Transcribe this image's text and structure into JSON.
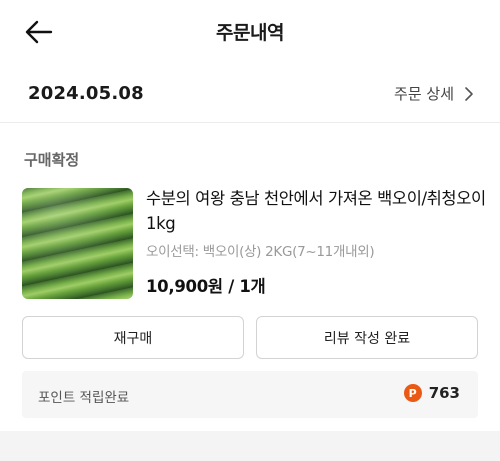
{
  "header": {
    "title": "주문내역",
    "back_icon": "arrow-left-icon"
  },
  "order": {
    "date": "2024.05.08",
    "detail_link_label": "주문 상세",
    "detail_icon": "chevron-right-icon",
    "status": "구매확정"
  },
  "product": {
    "name": "수분의 여왕 충남 천안에서 가져온 백오이/취청오이 1kg",
    "option": "오이선택: 백오이(상) 2KG(7~11개내외)",
    "price": "10,900원 / 1개",
    "thumbnail": "cucumber-photo"
  },
  "actions": {
    "rebuy_label": "재구매",
    "review_label": "리뷰 작성 완료"
  },
  "points": {
    "label": "포인트 적립완료",
    "icon_letter": "P",
    "value": "763"
  },
  "colors": {
    "point_badge": "#ea5a14",
    "option_text": "#9a9a9a",
    "points_background": "#f6f6f6"
  }
}
